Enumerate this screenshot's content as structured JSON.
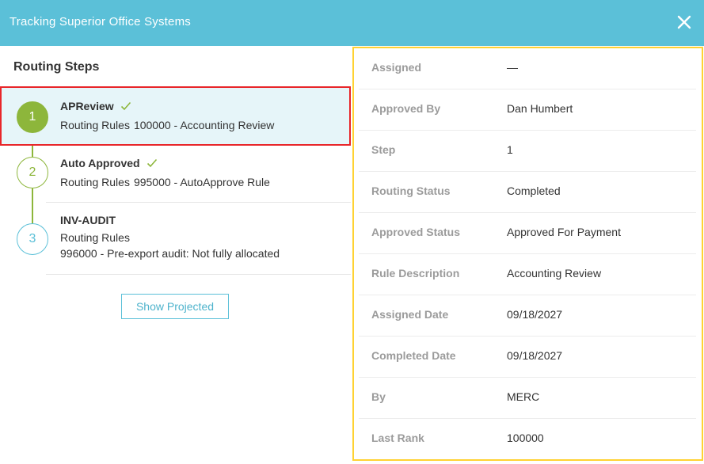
{
  "window": {
    "title": "Tracking Superior Office Systems",
    "colors": {
      "header": "#5bc0d8",
      "accent_green": "#8db63b",
      "pending_blue": "#5bc0d8",
      "highlight_red": "#e8262a",
      "highlight_yellow": "#ffd233"
    }
  },
  "routing": {
    "title": "Routing Steps",
    "steps": [
      {
        "number": "1",
        "name": "APReview",
        "status": "completed",
        "line1": "Routing Rules",
        "line1_value": "100000 - Accounting Review",
        "line2": ""
      },
      {
        "number": "2",
        "name": "Auto Approved",
        "status": "completed",
        "line1": "Routing Rules",
        "line1_value": "995000 - AutoApprove Rule",
        "line2": ""
      },
      {
        "number": "3",
        "name": "INV-AUDIT",
        "status": "pending",
        "line1": "Routing Rules",
        "line1_value": "",
        "line2": "996000 - Pre-export audit: Not fully allocated"
      }
    ],
    "show_projected_label": "Show Projected"
  },
  "details": [
    {
      "label": "Assigned",
      "value": "—"
    },
    {
      "label": "Approved By",
      "value": "Dan Humbert"
    },
    {
      "label": "Step",
      "value": "1"
    },
    {
      "label": "Routing Status",
      "value": "Completed"
    },
    {
      "label": "Approved Status",
      "value": "Approved For Payment"
    },
    {
      "label": "Rule Description",
      "value": "Accounting Review"
    },
    {
      "label": "Assigned Date",
      "value": "09/18/2027"
    },
    {
      "label": "Completed Date",
      "value": "09/18/2027"
    },
    {
      "label": "By",
      "value": "MERC"
    },
    {
      "label": "Last Rank",
      "value": "100000"
    }
  ]
}
